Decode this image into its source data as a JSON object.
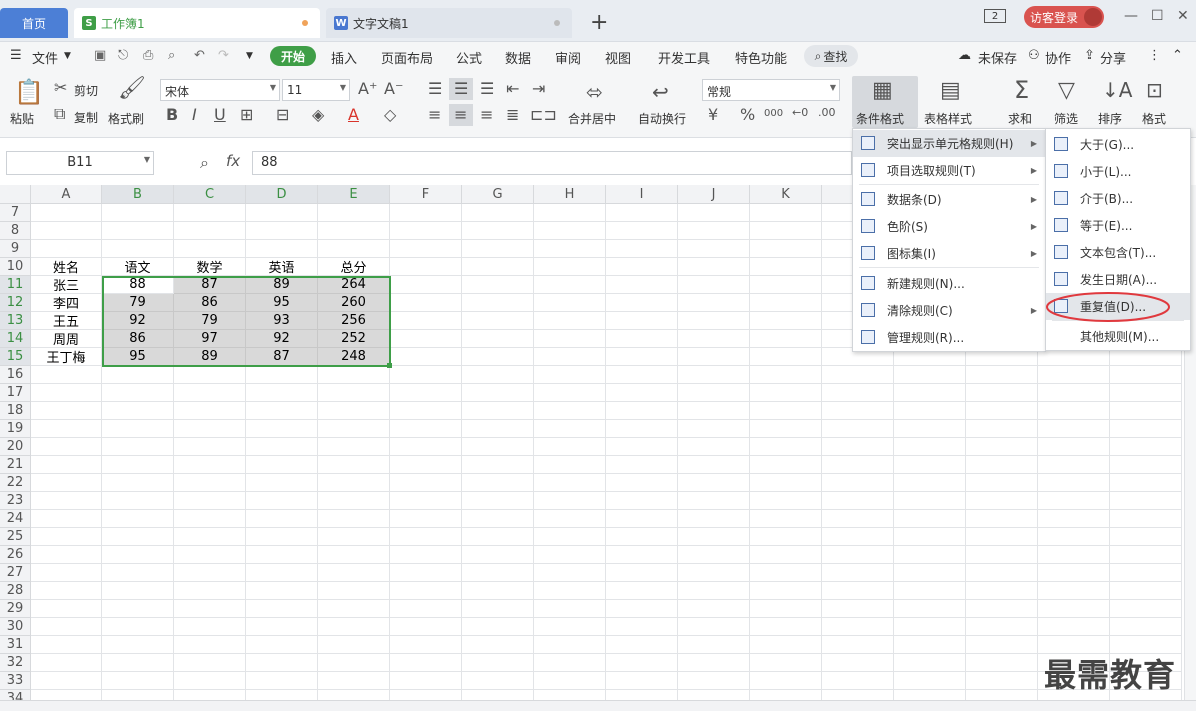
{
  "tabs": {
    "home": "首页",
    "sheet": "工作簿1",
    "doc": "文字文稿1",
    "plus": "+"
  },
  "window": {
    "badge": "2",
    "login": "访客登录",
    "min": "—",
    "max": "☐",
    "close": "✕"
  },
  "menu": {
    "file": "文件",
    "start": "开始",
    "insert": "插入",
    "layout": "页面布局",
    "formula": "公式",
    "data": "数据",
    "review": "审阅",
    "view": "视图",
    "dev": "开发工具",
    "special": "特色功能",
    "search": "查找",
    "unsaved": "未保存",
    "collab": "协作",
    "share": "分享"
  },
  "ribbon": {
    "cut": "剪切",
    "paste": "粘贴",
    "copy": "复制",
    "format_painter": "格式刷",
    "font_name": "宋体",
    "font_size": "11",
    "merge": "合并居中",
    "wrap": "自动换行",
    "number_format": "常规",
    "cond_format": "条件格式",
    "table_style": "表格样式",
    "sum": "求和",
    "filter": "筛选",
    "sort": "排序",
    "format": "格式",
    "bold": "B",
    "italic": "I",
    "underline": "U",
    "currency": "¥",
    "percent": "%",
    "thousand": "000"
  },
  "formula": {
    "cell_ref": "B11",
    "fx": "fx",
    "value": "88"
  },
  "columns": [
    "A",
    "B",
    "C",
    "D",
    "E",
    "F",
    "G",
    "H",
    "I",
    "J",
    "K"
  ],
  "rows": [
    "7",
    "8",
    "9",
    "10",
    "11",
    "12",
    "13",
    "14",
    "15",
    "16",
    "17",
    "18",
    "19",
    "20",
    "21",
    "22",
    "23",
    "24",
    "25",
    "26",
    "27",
    "28",
    "29",
    "30",
    "31",
    "32",
    "33",
    "34"
  ],
  "table": {
    "header": [
      "姓名",
      "语文",
      "数学",
      "英语",
      "总分"
    ],
    "body": [
      [
        "张三",
        "88",
        "87",
        "89",
        "264"
      ],
      [
        "李四",
        "79",
        "86",
        "95",
        "260"
      ],
      [
        "王五",
        "92",
        "79",
        "93",
        "256"
      ],
      [
        "周周",
        "86",
        "97",
        "92",
        "252"
      ],
      [
        "王丁梅",
        "95",
        "89",
        "87",
        "248"
      ]
    ]
  },
  "cf_menu": [
    "突出显示单元格规则(H)",
    "项目选取规则(T)",
    "数据条(D)",
    "色阶(S)",
    "图标集(I)",
    "新建规则(N)...",
    "清除规则(C)",
    "管理规则(R)..."
  ],
  "sub_menu": [
    "大于(G)...",
    "小于(L)...",
    "介于(B)...",
    "等于(E)...",
    "文本包含(T)...",
    "发生日期(A)...",
    "重复值(D)...",
    "其他规则(M)..."
  ],
  "watermark": "最需教育",
  "colors": {
    "accent": "#3f9e47",
    "highlight_circle": "#e0393e",
    "tab_home": "#4c7fd6"
  }
}
